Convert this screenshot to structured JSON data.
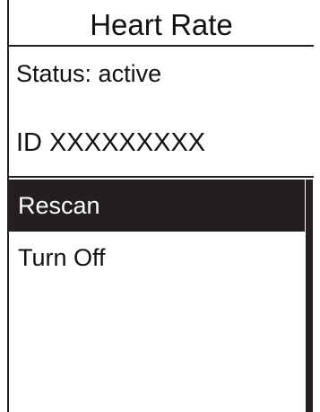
{
  "header": {
    "title": "Heart Rate"
  },
  "sensor": {
    "status": "Status: active",
    "id": "ID XXXXXXXXX"
  },
  "menu": {
    "items": [
      {
        "label": "Rescan",
        "selected": true
      },
      {
        "label": "Turn Off",
        "selected": false
      }
    ]
  },
  "colors": {
    "background": "#ffffff",
    "text": "#111111",
    "highlight": "#231f20",
    "highlight_text": "#ffffff"
  }
}
